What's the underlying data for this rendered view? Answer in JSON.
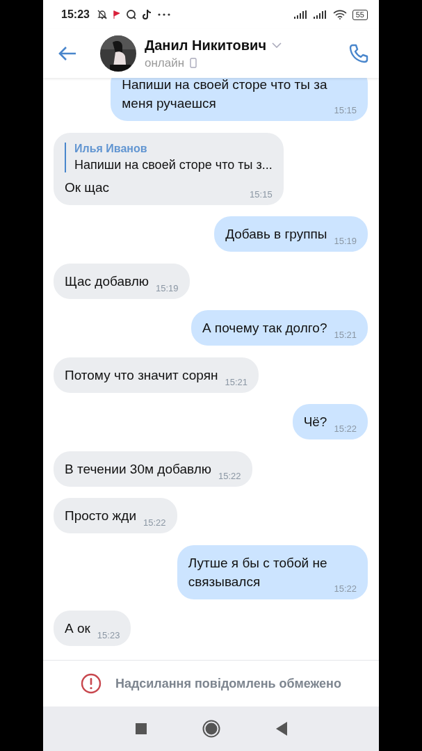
{
  "status_bar": {
    "time": "15:23",
    "battery": "55"
  },
  "header": {
    "name": "Данил Никитович",
    "status": "онлайн"
  },
  "messages": [
    {
      "kind": "out",
      "lines": [
        "Напиши на своей сторе что ты за",
        "меня ручаешся"
      ],
      "time": "15:15"
    },
    {
      "kind": "in",
      "reply": {
        "author": "Илья Иванов",
        "text": "Напиши на своей сторе что ты з..."
      },
      "lines": [
        "Ок щас"
      ],
      "time": "15:15"
    },
    {
      "kind": "out",
      "lines": [
        "Добавь в группы"
      ],
      "time": "15:19"
    },
    {
      "kind": "in",
      "lines": [
        "Щас добавлю"
      ],
      "time": "15:19"
    },
    {
      "kind": "out",
      "lines": [
        "А почему так долго?"
      ],
      "time": "15:21"
    },
    {
      "kind": "in",
      "lines": [
        "Потому что значит сорян"
      ],
      "time": "15:21"
    },
    {
      "kind": "out",
      "lines": [
        "Чё?"
      ],
      "time": "15:22"
    },
    {
      "kind": "in",
      "lines": [
        "В течении 30м добавлю"
      ],
      "time": "15:22"
    },
    {
      "kind": "in",
      "lines": [
        "Просто жди"
      ],
      "time": "15:22"
    },
    {
      "kind": "out",
      "lines": [
        "Лутше я бы с тобой не",
        "связывался"
      ],
      "time": "15:22"
    },
    {
      "kind": "in",
      "lines": [
        "А ок"
      ],
      "time": "15:23"
    }
  ],
  "notice": "Надсилання повідомлень обмежено"
}
